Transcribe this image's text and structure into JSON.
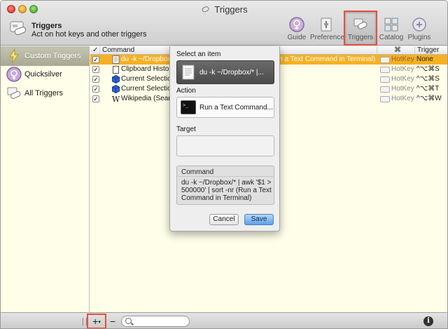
{
  "window": {
    "title": "Triggers"
  },
  "header": {
    "title": "Triggers",
    "subtitle": "Act on hot keys and other triggers"
  },
  "toolbar": {
    "items": [
      {
        "label": "Guide",
        "icon": "guide-icon"
      },
      {
        "label": "Preferences",
        "icon": "preferences-icon"
      },
      {
        "label": "Triggers",
        "icon": "triggers-icon",
        "selected": true
      },
      {
        "label": "Catalog",
        "icon": "catalog-icon"
      },
      {
        "label": "Plugins",
        "icon": "plugins-icon"
      }
    ]
  },
  "sidebar": {
    "items": [
      {
        "label": "Custom Triggers",
        "icon": "lightning-icon",
        "selected": true
      },
      {
        "label": "Quicksilver",
        "icon": "quicksilver-icon"
      },
      {
        "label": "All Triggers",
        "icon": "all-triggers-icon"
      }
    ]
  },
  "table": {
    "columns": {
      "check": "✓",
      "command": "Command",
      "type": "⌘",
      "trigger": "Trigger"
    },
    "rows": [
      {
        "checked": true,
        "command": "du -k ~/Dropbox/* | awk '$1 > 500000' | sort -nr (Run a Text Command in Terminal)",
        "type": "HotKey",
        "trigger": "None",
        "selected": true,
        "icon": "document-icon"
      },
      {
        "checked": true,
        "command": "Clipboard History",
        "type": "HotKey",
        "trigger": "^⌥⌘S",
        "icon": "clipboard-icon"
      },
      {
        "checked": true,
        "command": "Current Selection",
        "type": "HotKey",
        "trigger": "^⌥⌘S",
        "icon": "cube-icon"
      },
      {
        "checked": true,
        "command": "Current Selection",
        "type": "HotKey",
        "trigger": "^⌥⌘T",
        "icon": "cube-icon"
      },
      {
        "checked": true,
        "command": "Wikipedia (Search)",
        "type": "HotKey",
        "trigger": "^⌥⌘W",
        "icon": "wikipedia-icon"
      }
    ]
  },
  "popover": {
    "select_item_label": "Select an item",
    "item_text": "du -k ~/Dropbox/* |...",
    "action_label": "Action",
    "action_text": "Run a Text Command...",
    "target_label": "Target",
    "command_caption": "Command",
    "command_text": "du -k ~/Dropbox/* | awk '$1 > 500000' | sort -nr (Run a Text Command in Terminal)",
    "cancel_label": "Cancel",
    "save_label": "Save"
  },
  "bottombar": {
    "add_label": "+",
    "remove_label": "−",
    "search_placeholder": "",
    "info_label": "i"
  },
  "colors": {
    "selection": "#f6b023",
    "highlight": "#e0533d",
    "save_button": "#5ea0e8",
    "sidebar_bg": "#fffee8"
  }
}
